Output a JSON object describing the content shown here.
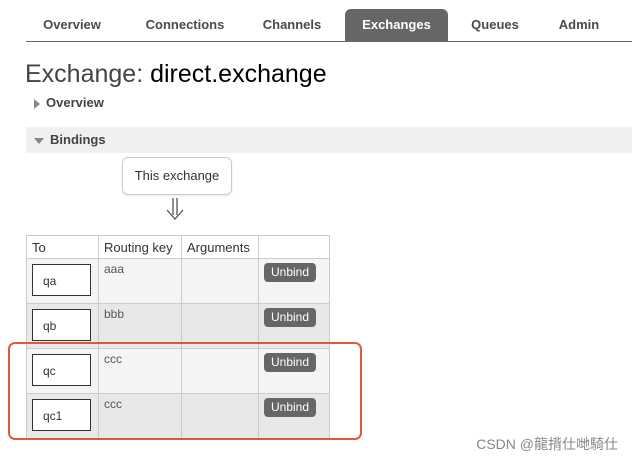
{
  "nav": {
    "tabs": [
      {
        "label": "Overview"
      },
      {
        "label": "Connections"
      },
      {
        "label": "Channels"
      },
      {
        "label": "Exchanges",
        "active": true
      },
      {
        "label": "Queues"
      },
      {
        "label": "Admin"
      }
    ]
  },
  "title": {
    "prefix": "Exchange: ",
    "name": "direct.exchange"
  },
  "sections": {
    "overview": "Overview",
    "bindings": "Bindings"
  },
  "diagram": {
    "this_exchange": "This exchange"
  },
  "table": {
    "headers": {
      "to": "To",
      "routing_key": "Routing key",
      "arguments": "Arguments",
      "actions": ""
    },
    "rows": [
      {
        "to": "qa",
        "routing_key": "aaa",
        "arguments": "",
        "action": "Unbind"
      },
      {
        "to": "qb",
        "routing_key": "bbb",
        "arguments": "",
        "action": "Unbind"
      },
      {
        "to": "qc",
        "routing_key": "ccc",
        "arguments": "",
        "action": "Unbind"
      },
      {
        "to": "qc1",
        "routing_key": "ccc",
        "arguments": "",
        "action": "Unbind"
      }
    ]
  },
  "watermark": "CSDN @龍揹仕哋騎仕",
  "colors": {
    "tab_active": "#666666",
    "highlight": "#e05a3a",
    "button": "#666666"
  }
}
